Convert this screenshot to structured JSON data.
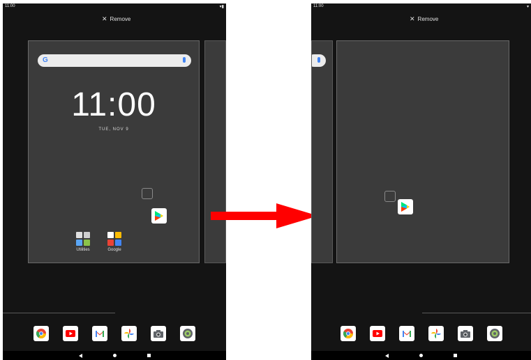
{
  "left_screen": {
    "status_time": "11:00",
    "remove_label": "Remove",
    "clock": "11:00",
    "date": "TUE, NOV 9",
    "folders": [
      {
        "label": "Utilities"
      },
      {
        "label": "Google"
      }
    ]
  },
  "right_screen": {
    "status_time": "11:00",
    "remove_label": "Remove"
  },
  "dock_icons": [
    "chrome-icon",
    "youtube-icon",
    "gmail-icon",
    "photos-icon",
    "camera-icon",
    "settings-icon"
  ],
  "colors": {
    "background": "#141414",
    "card": "#3b3b3b",
    "arrow": "#ff0000"
  }
}
